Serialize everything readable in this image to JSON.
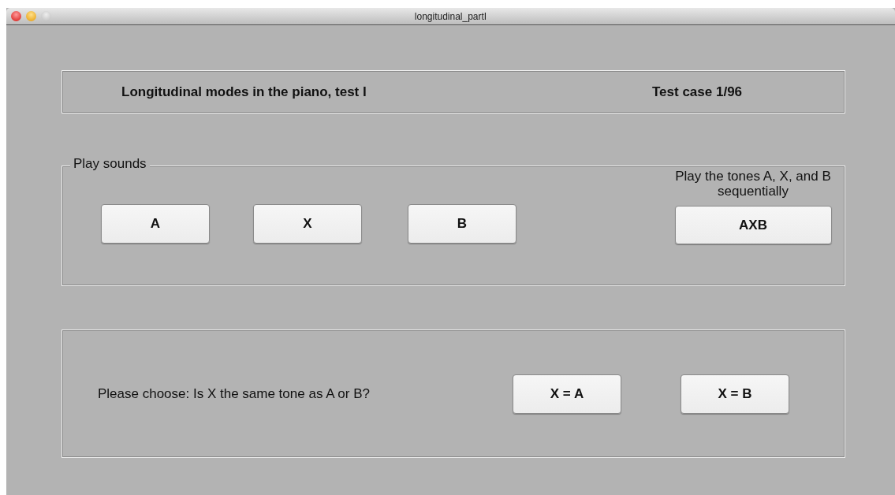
{
  "window": {
    "title": "longitudinal_partI"
  },
  "header": {
    "title": "Longitudinal modes in the piano, test I",
    "test_case": "Test case 1/96"
  },
  "play_panel": {
    "label": "Play sounds",
    "buttons": [
      "A",
      "X",
      "B"
    ],
    "sequence_caption": "Play the tones A, X, and B sequentially",
    "sequence_button": "AXB"
  },
  "choice_panel": {
    "prompt": "Please choose: Is X the same tone as A or B?",
    "buttons": [
      "X = A",
      "X = B"
    ]
  }
}
